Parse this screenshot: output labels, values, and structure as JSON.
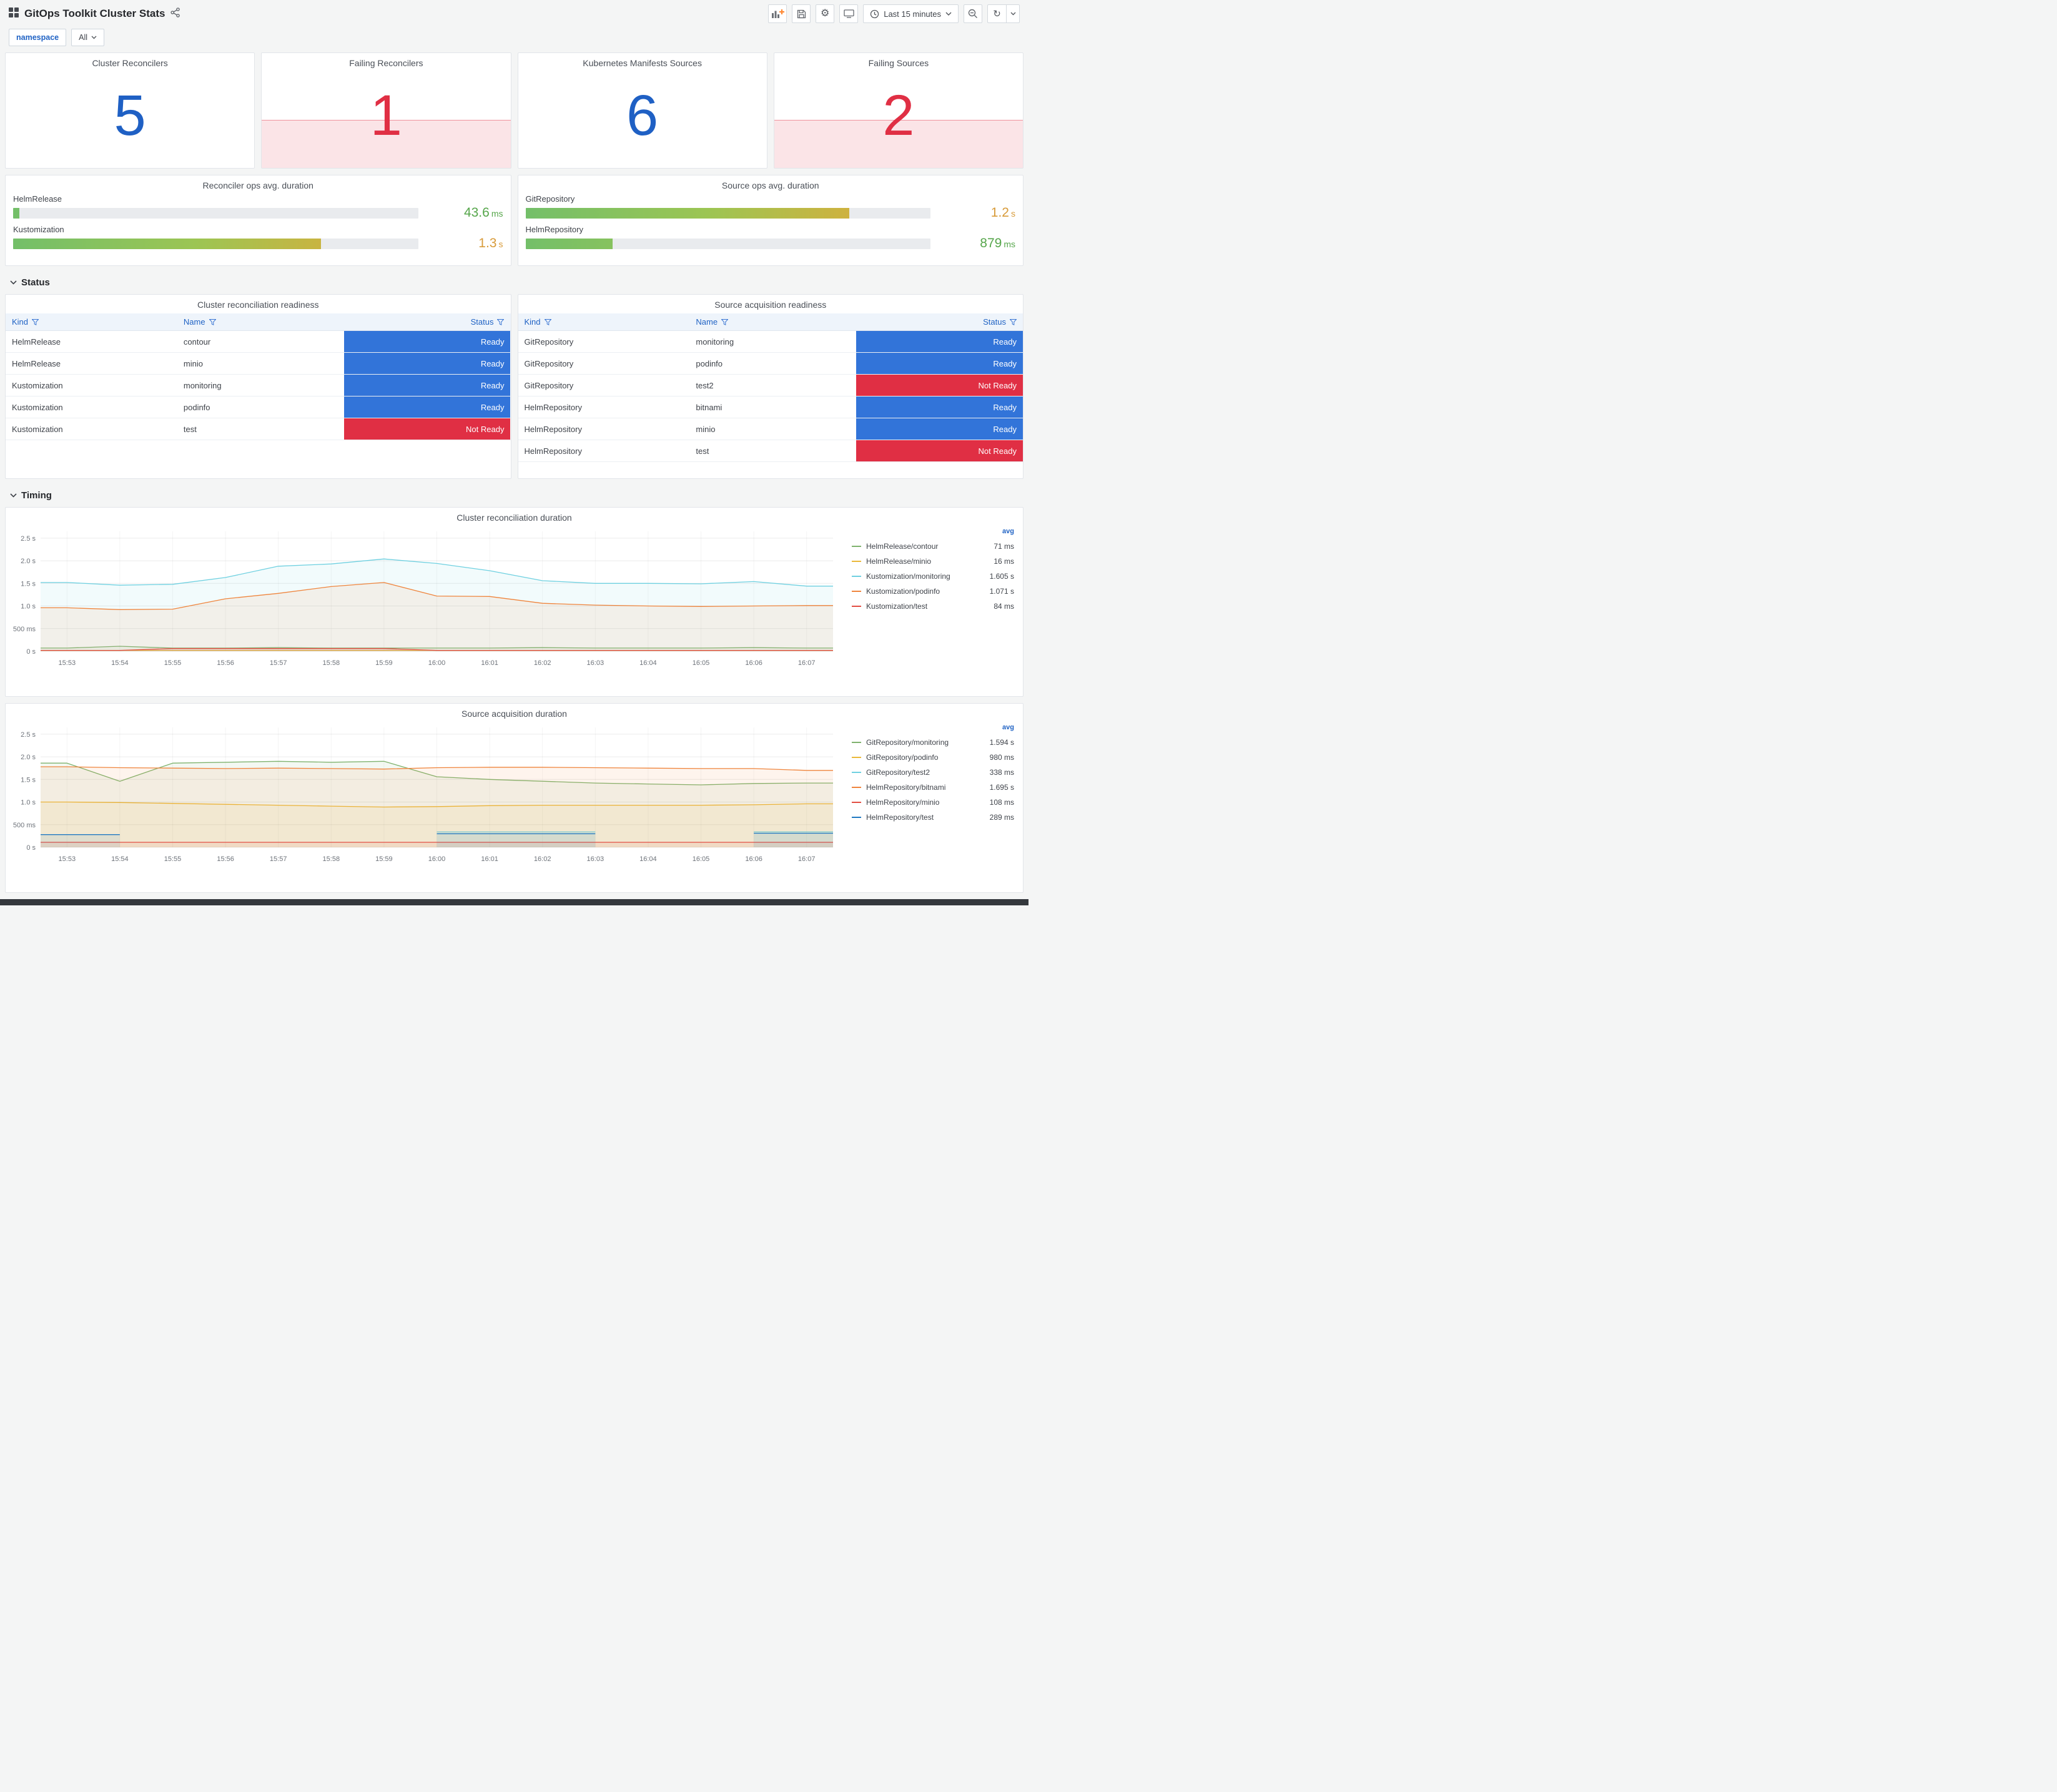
{
  "header": {
    "title": "GitOps Toolkit Cluster Stats",
    "time_picker": "Last 15 minutes"
  },
  "variables": {
    "label": "namespace",
    "value": "All"
  },
  "sections": {
    "status": "Status",
    "timing": "Timing"
  },
  "stats": [
    {
      "title": "Cluster Reconcilers",
      "value": "5",
      "state": "ok",
      "color": "#1f60c4"
    },
    {
      "title": "Failing Reconcilers",
      "value": "1",
      "state": "alert",
      "color": "#e02f44"
    },
    {
      "title": "Kubernetes Manifests Sources",
      "value": "6",
      "state": "ok",
      "color": "#1f60c4"
    },
    {
      "title": "Failing Sources",
      "value": "2",
      "state": "alert",
      "color": "#e02f44"
    }
  ],
  "gauges": [
    {
      "title": "Reconciler ops avg. duration",
      "rows": [
        {
          "label": "HelmRelease",
          "value": "43.6",
          "unit": "ms",
          "percent": 1.5,
          "value_color": "#56a64b"
        },
        {
          "label": "Kustomization",
          "value": "1.3",
          "unit": "s",
          "percent": 76,
          "value_color": "#d89b3a"
        }
      ]
    },
    {
      "title": "Source ops avg. duration",
      "rows": [
        {
          "label": "GitRepository",
          "value": "1.2",
          "unit": "s",
          "percent": 80,
          "value_color": "#d89b3a"
        },
        {
          "label": "HelmRepository",
          "value": "879",
          "unit": "ms",
          "percent": 21.5,
          "value_color": "#56a64b"
        }
      ]
    }
  ],
  "status_colors": {
    "Ready": "#3274d9",
    "Not Ready": "#e02f44"
  },
  "tables": [
    {
      "title": "Cluster reconciliation readiness",
      "columns": [
        "Kind",
        "Name",
        "Status"
      ],
      "rows": [
        [
          "HelmRelease",
          "contour",
          "Ready"
        ],
        [
          "HelmRelease",
          "minio",
          "Ready"
        ],
        [
          "Kustomization",
          "monitoring",
          "Ready"
        ],
        [
          "Kustomization",
          "podinfo",
          "Ready"
        ],
        [
          "Kustomization",
          "test",
          "Not Ready"
        ]
      ]
    },
    {
      "title": "Source acquisition readiness",
      "columns": [
        "Kind",
        "Name",
        "Status"
      ],
      "rows": [
        [
          "GitRepository",
          "monitoring",
          "Ready"
        ],
        [
          "GitRepository",
          "podinfo",
          "Ready"
        ],
        [
          "GitRepository",
          "test2",
          "Not Ready"
        ],
        [
          "HelmRepository",
          "bitnami",
          "Ready"
        ],
        [
          "HelmRepository",
          "minio",
          "Ready"
        ],
        [
          "HelmRepository",
          "test",
          "Not Ready"
        ]
      ]
    }
  ],
  "chart_data": [
    {
      "type": "line",
      "title": "Cluster reconciliation duration",
      "legend_header": "avg",
      "legend_position": "right",
      "grid": true,
      "ylim": [
        0,
        2.65
      ],
      "yticks": [
        {
          "v": 0,
          "label": "0 s"
        },
        {
          "v": 0.5,
          "label": "500 ms"
        },
        {
          "v": 1,
          "label": "1.0 s"
        },
        {
          "v": 1.5,
          "label": "1.5 s"
        },
        {
          "v": 2,
          "label": "2.0 s"
        },
        {
          "v": 2.5,
          "label": "2.5 s"
        }
      ],
      "x": [
        "15:53",
        "15:54",
        "15:55",
        "15:56",
        "15:57",
        "15:58",
        "15:59",
        "16:00",
        "16:01",
        "16:02",
        "16:03",
        "16:04",
        "16:05",
        "16:06",
        "16:07"
      ],
      "series": [
        {
          "name": "HelmRelease/contour",
          "color": "#7EB26D",
          "avg": "71 ms",
          "values": [
            0.07,
            0.11,
            0.07,
            0.07,
            0.08,
            0.07,
            0.07,
            0.07,
            0.07,
            0.08,
            0.07,
            0.07,
            0.07,
            0.08,
            0.07
          ]
        },
        {
          "name": "HelmRelease/minio",
          "color": "#EAB839",
          "avg": "16 ms",
          "values": [
            0.02,
            0.02,
            0.02,
            0.02,
            0.02,
            0.02,
            0.02,
            0.02,
            0.02,
            0.02,
            0.02,
            0.02,
            0.02,
            0.02,
            0.02
          ]
        },
        {
          "name": "Kustomization/monitoring",
          "color": "#6ED0E0",
          "avg": "1.605 s",
          "values": [
            1.52,
            1.46,
            1.48,
            1.63,
            1.88,
            1.93,
            2.04,
            1.94,
            1.78,
            1.56,
            1.5,
            1.5,
            1.49,
            1.54,
            1.44
          ]
        },
        {
          "name": "Kustomization/podinfo",
          "color": "#EF843C",
          "avg": "1.071 s",
          "values": [
            0.96,
            0.92,
            0.93,
            1.16,
            1.28,
            1.43,
            1.52,
            1.22,
            1.21,
            1.06,
            1.02,
            1.0,
            0.99,
            1.0,
            1.01
          ]
        },
        {
          "name": "Kustomization/test",
          "color": "#E24D42",
          "avg": "84 ms",
          "values": [
            0.02,
            0.02,
            0.06,
            0.06,
            0.06,
            0.06,
            0.06,
            0.02,
            0.02,
            0.02,
            0.02,
            0.02,
            0.02,
            0.02,
            0.02
          ]
        }
      ]
    },
    {
      "type": "line",
      "title": "Source acquisition duration",
      "legend_header": "avg",
      "legend_position": "right",
      "grid": true,
      "ylim": [
        0,
        2.65
      ],
      "yticks": [
        {
          "v": 0,
          "label": "0 s"
        },
        {
          "v": 0.5,
          "label": "500 ms"
        },
        {
          "v": 1,
          "label": "1.0 s"
        },
        {
          "v": 1.5,
          "label": "1.5 s"
        },
        {
          "v": 2,
          "label": "2.0 s"
        },
        {
          "v": 2.5,
          "label": "2.5 s"
        }
      ],
      "x": [
        "15:53",
        "15:54",
        "15:55",
        "15:56",
        "15:57",
        "15:58",
        "15:59",
        "16:00",
        "16:01",
        "16:02",
        "16:03",
        "16:04",
        "16:05",
        "16:06",
        "16:07"
      ],
      "series": [
        {
          "name": "GitRepository/monitoring",
          "color": "#7EB26D",
          "avg": "1.594 s",
          "values": [
            1.86,
            1.46,
            1.86,
            1.88,
            1.9,
            1.88,
            1.9,
            1.56,
            1.5,
            1.46,
            1.42,
            1.4,
            1.38,
            1.41,
            1.42
          ]
        },
        {
          "name": "GitRepository/podinfo",
          "color": "#EAB839",
          "avg": "980 ms",
          "values": [
            1.0,
            0.99,
            0.97,
            0.95,
            0.93,
            0.91,
            0.89,
            0.9,
            0.92,
            0.93,
            0.93,
            0.93,
            0.93,
            0.94,
            0.96
          ]
        },
        {
          "name": "GitRepository/test2",
          "color": "#6ED0E0",
          "avg": "338 ms",
          "values": [
            null,
            null,
            null,
            null,
            null,
            null,
            null,
            0.34,
            0.34,
            0.34,
            0.34,
            null,
            null,
            0.34,
            0.34
          ]
        },
        {
          "name": "HelmRepository/bitnami",
          "color": "#EF843C",
          "avg": "1.695 s",
          "values": [
            1.78,
            1.76,
            1.75,
            1.74,
            1.75,
            1.74,
            1.73,
            1.76,
            1.77,
            1.77,
            1.76,
            1.75,
            1.74,
            1.74,
            1.7
          ]
        },
        {
          "name": "HelmRepository/minio",
          "color": "#E24D42",
          "avg": "108 ms",
          "values": [
            0.11,
            0.11,
            0.11,
            0.11,
            0.11,
            0.11,
            0.11,
            0.11,
            0.11,
            0.11,
            0.11,
            0.11,
            0.11,
            0.11,
            0.11
          ]
        },
        {
          "name": "HelmRepository/test",
          "color": "#1F78C1",
          "avg": "289 ms",
          "values": [
            0.28,
            0.28,
            null,
            null,
            null,
            null,
            null,
            0.3,
            0.3,
            0.3,
            0.3,
            null,
            null,
            0.31,
            0.31
          ]
        }
      ]
    }
  ]
}
